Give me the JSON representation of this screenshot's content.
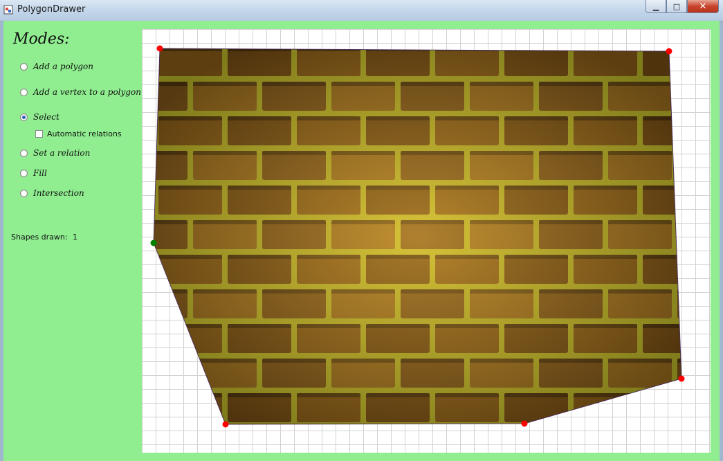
{
  "window": {
    "title": "PolygonDrawer",
    "buttons": {
      "minimize": "▁",
      "maximize": "□",
      "close": "✕"
    }
  },
  "modes": {
    "title": "Modes:",
    "options": [
      {
        "label": "Add a polygon",
        "checked": false
      },
      {
        "label": "Add a vertex to a polygon",
        "checked": false
      },
      {
        "label": "Select",
        "checked": true
      },
      {
        "label": "Set a relation",
        "checked": false
      },
      {
        "label": "Fill",
        "checked": false
      },
      {
        "label": "Intersection",
        "checked": false
      }
    ],
    "automatic_relations": {
      "label": "Automatic relations",
      "checked": false
    }
  },
  "stats": {
    "shapes_drawn_label": "Shapes drawn:",
    "shapes_drawn_value": "1"
  },
  "colors": {
    "background": "#90ee90",
    "vertex": "#ff0000",
    "selected_vertex": "#008000",
    "mortar": "#b8b422",
    "brick": "#9a6a1a"
  },
  "icons": {
    "app": "polygon-app-icon",
    "vertex": "vertex-dot-icon"
  }
}
